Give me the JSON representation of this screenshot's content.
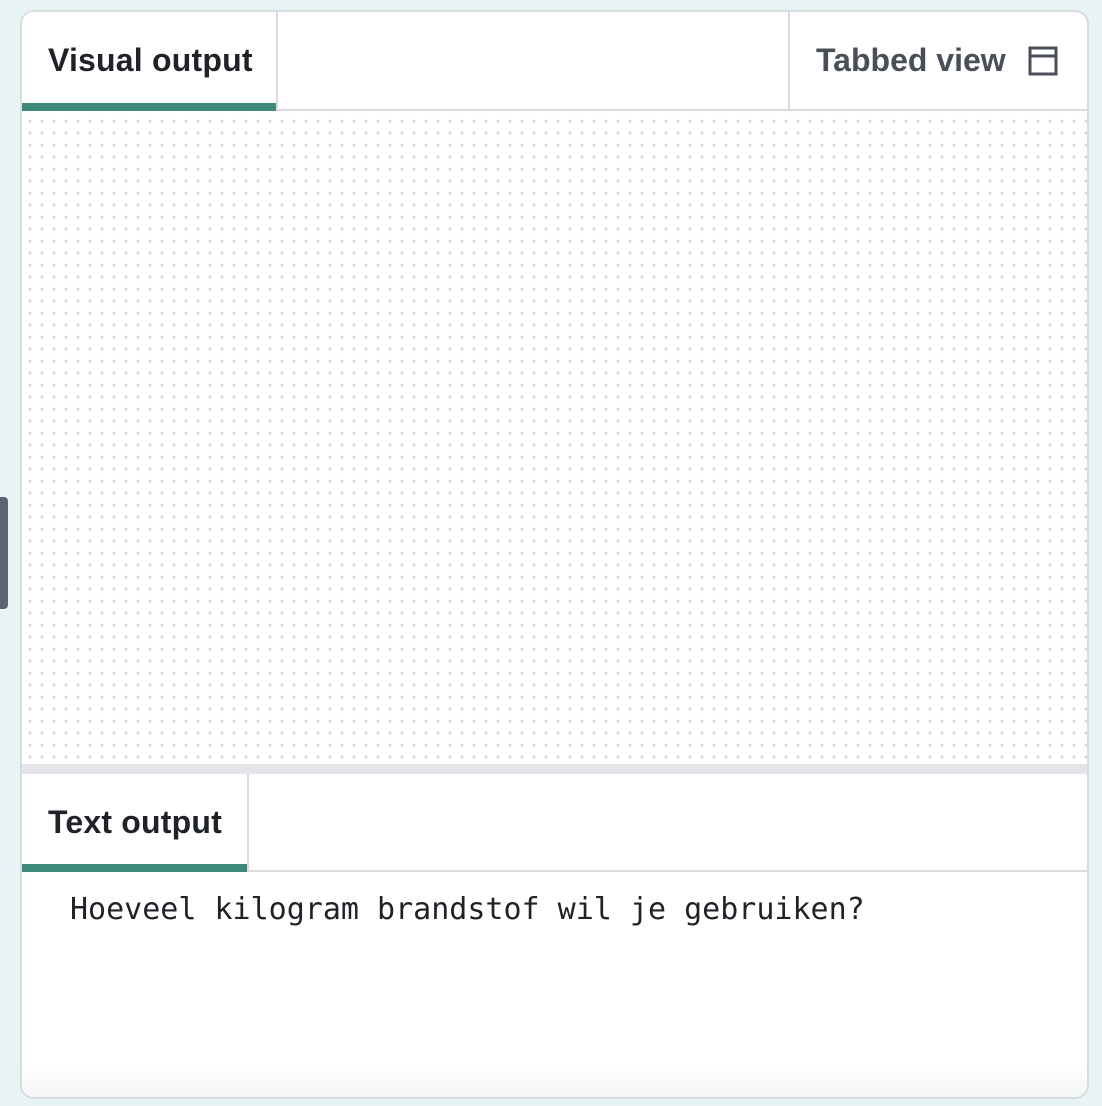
{
  "visual_panel": {
    "tab_label": "Visual output",
    "tabbed_view_label": "Tabbed view",
    "tabbed_view_icon": "window-icon"
  },
  "text_panel": {
    "tab_label": "Text output",
    "lines": [
      "Hoeveel kilogram brandstof wil je gebruiken?"
    ]
  },
  "colors": {
    "accent": "#3d8a7b",
    "background": "#e8f4f3",
    "border": "#d9dbe0"
  }
}
